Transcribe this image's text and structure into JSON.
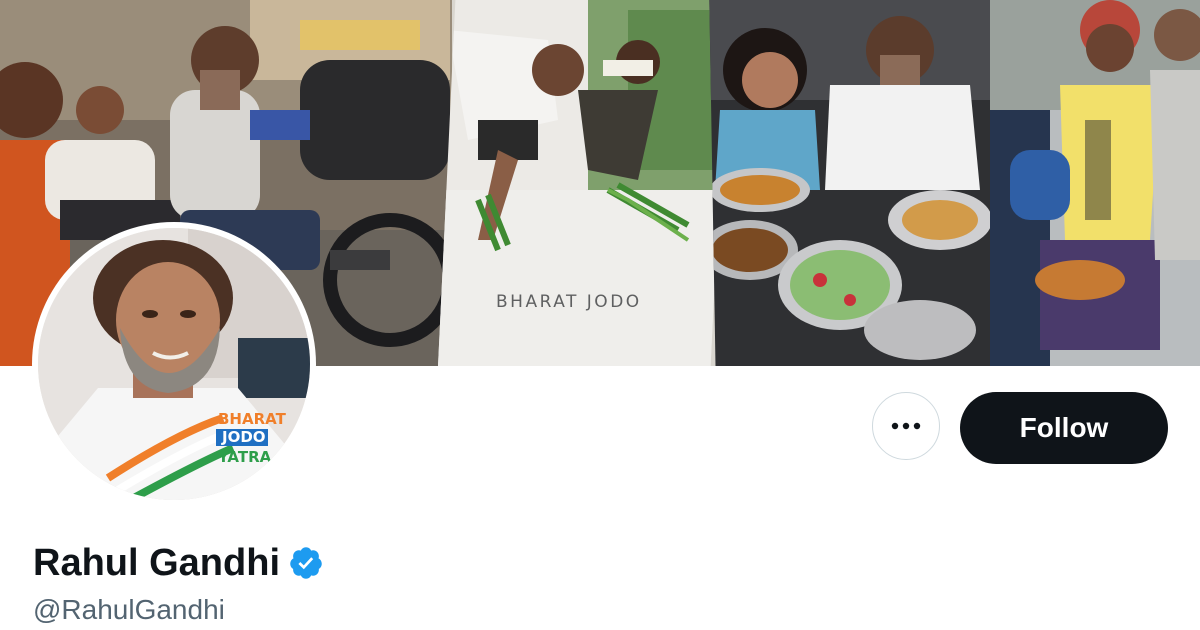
{
  "banner": {
    "caption": "BHARAT JODO",
    "logo_text": [
      "BHARAT",
      "JODO",
      "YATRA"
    ]
  },
  "profile": {
    "display_name": "Rahul Gandhi",
    "handle": "@RahulGandhi",
    "verified": true
  },
  "actions": {
    "more_icon": "more-horizontal-icon",
    "follow_label": "Follow"
  },
  "colors": {
    "follow_bg": "#0f1419",
    "follow_text": "#ffffff",
    "verified_blue": "#1d9bf0",
    "handle_gray": "#536471",
    "name_text": "#0f1419",
    "logo_saffron": "#f07f2a",
    "logo_green": "#2e9e4a",
    "logo_blue": "#1f6fc2"
  }
}
